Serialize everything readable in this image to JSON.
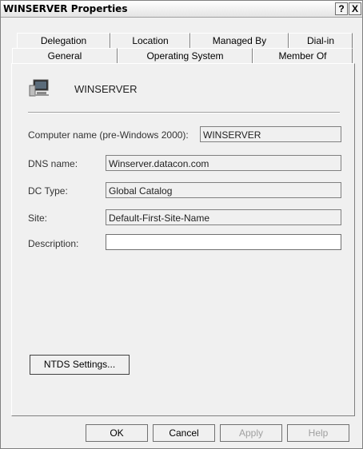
{
  "window": {
    "title": "WINSERVER Properties",
    "help_label": "?",
    "close_label": "X"
  },
  "tabs": {
    "row1": [
      "Delegation",
      "Location",
      "Managed By",
      "Dial-in"
    ],
    "row2": [
      "General",
      "Operating System",
      "Member Of"
    ],
    "active": "General"
  },
  "general": {
    "computer_name_display": "WINSERVER",
    "fields": {
      "computer_name_label": "Computer name (pre-Windows 2000):",
      "computer_name_value": "WINSERVER",
      "dns_label": "DNS name:",
      "dns_value": "Winserver.datacon.com",
      "dctype_label": "DC Type:",
      "dctype_value": "Global Catalog",
      "site_label": "Site:",
      "site_value": "Default-First-Site-Name",
      "description_label": "Description:",
      "description_value": ""
    },
    "ntds_button": "NTDS Settings..."
  },
  "footer": {
    "ok": "OK",
    "cancel": "Cancel",
    "apply": "Apply",
    "help": "Help"
  },
  "icons": {
    "computer": "computer-icon"
  }
}
